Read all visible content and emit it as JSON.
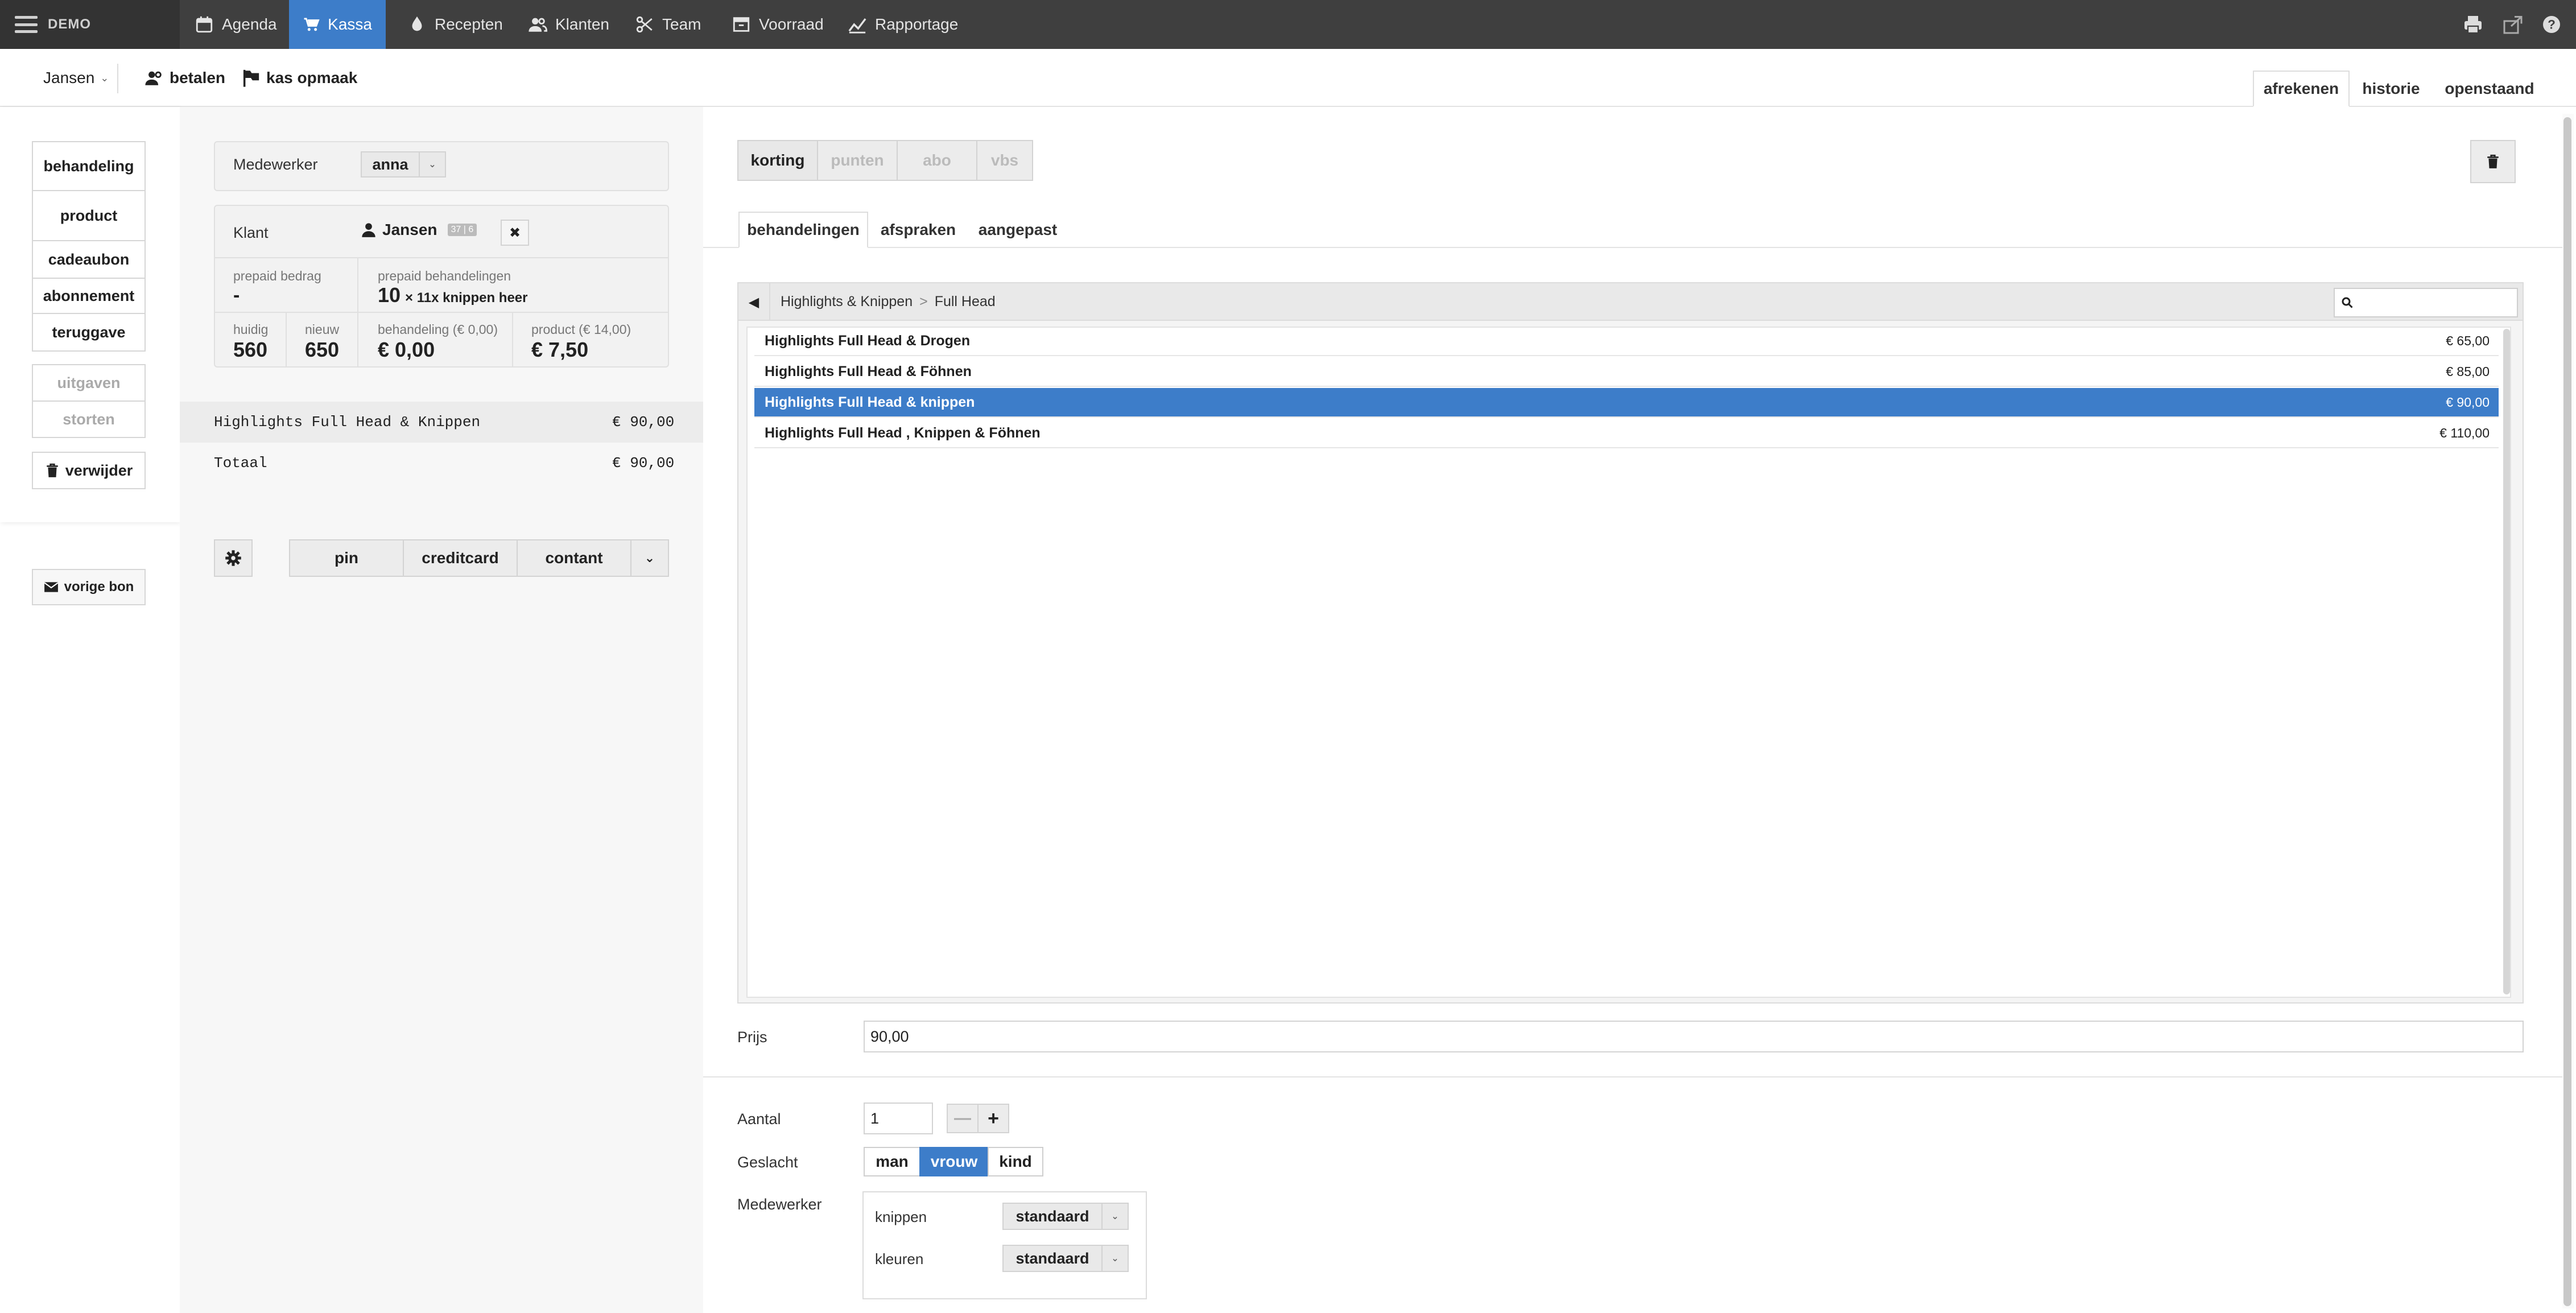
{
  "nav": {
    "brand": "DEMO",
    "items": [
      {
        "label": "Agenda",
        "icon": "calendar-icon"
      },
      {
        "label": "Kassa",
        "icon": "cart-icon"
      },
      {
        "label": "Recepten",
        "icon": "drop-icon"
      },
      {
        "label": "Klanten",
        "icon": "users-icon"
      },
      {
        "label": "Team",
        "icon": "scissors-icon"
      },
      {
        "label": "Voorraad",
        "icon": "box-icon"
      },
      {
        "label": "Rapportage",
        "icon": "chart-icon"
      }
    ],
    "active": "Kassa",
    "accent": "#3d7dc9"
  },
  "subbar": {
    "customer_select": "Jansen",
    "betalen": "betalen",
    "kas_opmaak": "kas opmaak",
    "tabs": [
      "afrekenen",
      "historie",
      "openstaand"
    ],
    "active_tab": "afrekenen"
  },
  "left": {
    "buttons": [
      "behandeling",
      "product",
      "cadeaubon",
      "abonnement",
      "teruggave"
    ],
    "dim_buttons": [
      "uitgaven",
      "storten"
    ],
    "delete": "verwijder",
    "previous": "vorige bon"
  },
  "middle": {
    "medewerker_label": "Medewerker",
    "medewerker_value": "anna",
    "klant_label": "Klant",
    "klant_name": "Jansen",
    "klant_badge": "37 | 6",
    "prepaid_bedrag_label": "prepaid bedrag",
    "prepaid_bedrag_value": "-",
    "prepaid_behandelingen_label": "prepaid behandelingen",
    "prepaid_behandelingen_count": "10",
    "prepaid_behandelingen_text": "× 11x knippen heer",
    "huidig_label": "huidig",
    "huidig_value": "560",
    "nieuw_label": "nieuw",
    "nieuw_value": "650",
    "behandeling_label": "behandeling (€ 0,00)",
    "behandeling_value": "€ 0,00",
    "product_label": "product (€ 14,00)",
    "product_value": "€ 7,50",
    "line_item": "Highlights Full Head & Knippen",
    "line_price": "€ 90,00",
    "total_label": "Totaal",
    "total_price": "€ 90,00",
    "pay_methods": [
      "pin",
      "creditcard",
      "contant"
    ]
  },
  "right": {
    "segments": [
      "korting",
      "punten",
      "abo",
      "vbs"
    ],
    "tabs": [
      "behandelingen",
      "afspraken",
      "aangepast"
    ],
    "active_tab": "behandelingen",
    "breadcrumb": [
      "Highlights & Knippen",
      ">",
      "Full Head"
    ],
    "search_placeholder": "",
    "rows": [
      {
        "name": "Highlights Full Head & Drogen",
        "price": "€ 65,00"
      },
      {
        "name": "Highlights Full Head & Föhnen",
        "price": "€ 85,00"
      },
      {
        "name": "Highlights Full Head & knippen",
        "price": "€ 90,00"
      },
      {
        "name": "Highlights Full Head , Knippen & Föhnen",
        "price": "€ 110,00"
      }
    ],
    "selected_row": 2,
    "prijs_label": "Prijs",
    "prijs_value": "90,00",
    "aantal_label": "Aantal",
    "aantal_value": "1",
    "geslacht_label": "Geslacht",
    "geslacht_options": [
      "man",
      "vrouw",
      "kind"
    ],
    "geslacht_selected": "vrouw",
    "medewerker_label": "Medewerker",
    "medewerker_rows": [
      {
        "label": "knippen",
        "value": "standaard"
      },
      {
        "label": "kleuren",
        "value": "standaard"
      }
    ]
  }
}
